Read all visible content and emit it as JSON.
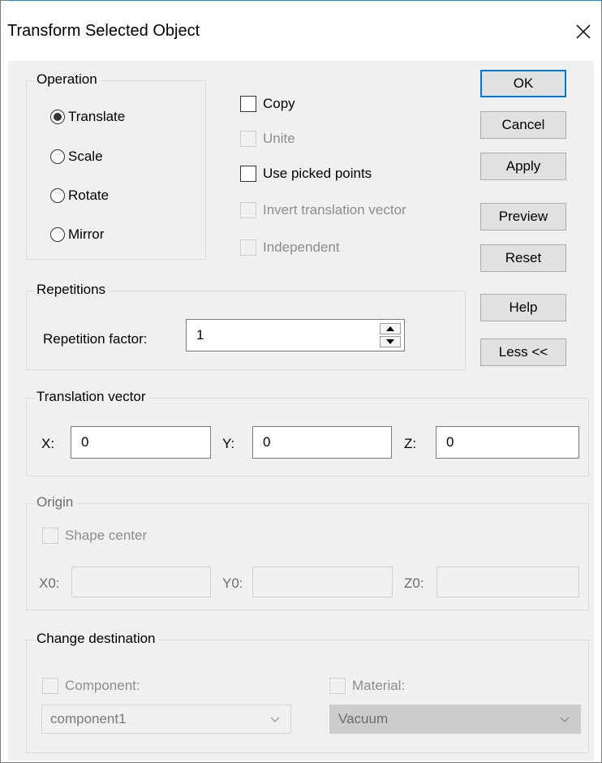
{
  "window": {
    "title": "Transform Selected Object"
  },
  "operation": {
    "label": "Operation",
    "options": [
      "Translate",
      "Scale",
      "Rotate",
      "Mirror"
    ],
    "selected": "Translate"
  },
  "options": {
    "copy": {
      "label": "Copy",
      "checked": false,
      "enabled": true
    },
    "unite": {
      "label": "Unite",
      "checked": false,
      "enabled": false
    },
    "use_picked_points": {
      "label": "Use picked points",
      "checked": false,
      "enabled": true
    },
    "invert_translation": {
      "label": "Invert translation vector",
      "checked": false,
      "enabled": false
    },
    "independent": {
      "label": "Independent",
      "checked": false,
      "enabled": false
    }
  },
  "buttons": {
    "ok": "OK",
    "cancel": "Cancel",
    "apply": "Apply",
    "preview": "Preview",
    "reset": "Reset",
    "help": "Help",
    "less": "Less <<"
  },
  "repetitions": {
    "label": "Repetitions",
    "factor_label": "Repetition factor:",
    "factor_value": "1"
  },
  "translation": {
    "label": "Translation vector",
    "x_label": "X:",
    "x_value": "0",
    "y_label": "Y:",
    "y_value": "0",
    "z_label": "Z:",
    "z_value": "0"
  },
  "origin": {
    "label": "Origin",
    "shape_center_label": "Shape center",
    "x0_label": "X0:",
    "x0_value": "",
    "y0_label": "Y0:",
    "y0_value": "",
    "z0_label": "Z0:",
    "z0_value": ""
  },
  "destination": {
    "label": "Change destination",
    "component_label": "Component:",
    "component_value": "component1",
    "material_label": "Material:",
    "material_value": "Vacuum"
  },
  "icons": {
    "close": "close-icon",
    "spin_up": "arrow-up-icon",
    "spin_down": "arrow-down-icon",
    "dropdown": "chevron-down-icon"
  },
  "colors": {
    "default_button_border": "#0078d7",
    "window_bg": "#f0f0f0",
    "disabled_text": "#8d8d8d"
  }
}
